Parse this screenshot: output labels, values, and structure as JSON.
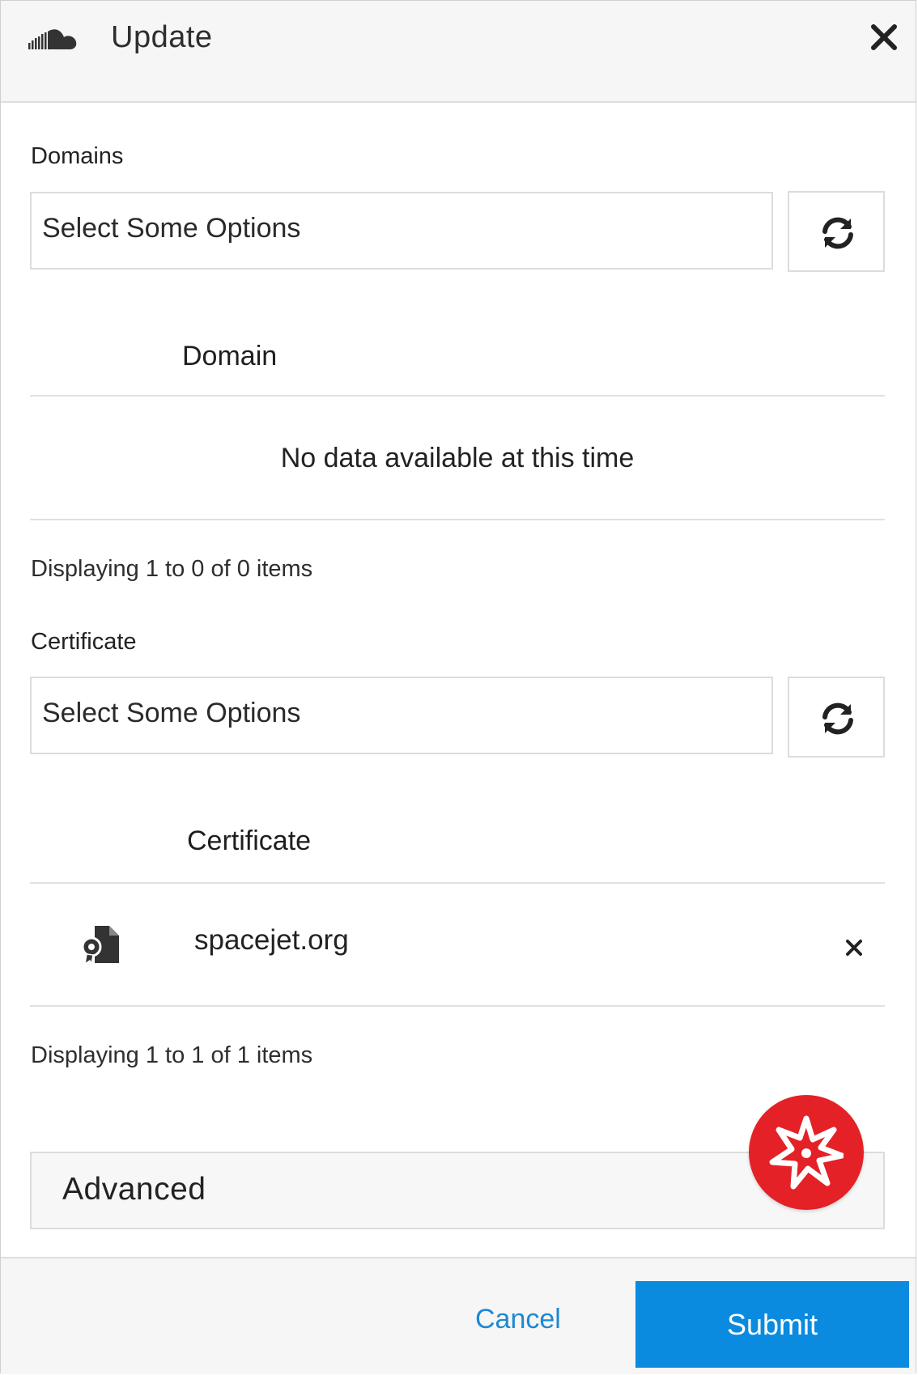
{
  "dialog": {
    "title": "Update",
    "logo_icon": "cloud-icon",
    "close_icon": "close-icon"
  },
  "domains": {
    "label": "Domains",
    "select_placeholder": "Select Some Options",
    "refresh_icon": "refresh-icon",
    "table": {
      "column_header": "Domain",
      "empty_message": "No data available at this time",
      "count_text": "Displaying 1 to 0 of 0 items"
    }
  },
  "certificate": {
    "label": "Certificate",
    "select_placeholder": "Select Some Options",
    "refresh_icon": "refresh-icon",
    "table": {
      "column_header": "Certificate",
      "rows": [
        {
          "icon": "certificate-file-icon",
          "name": "spacejet.org",
          "remove_icon": "remove-icon"
        }
      ],
      "count_text": "Displaying 1 to 1 of 1 items"
    }
  },
  "advanced": {
    "label": "Advanced"
  },
  "fab": {
    "icon": "starburst-icon",
    "color": "#e42127"
  },
  "footer": {
    "cancel_label": "Cancel",
    "submit_label": "Submit",
    "accent_color": "#0a8be0"
  }
}
